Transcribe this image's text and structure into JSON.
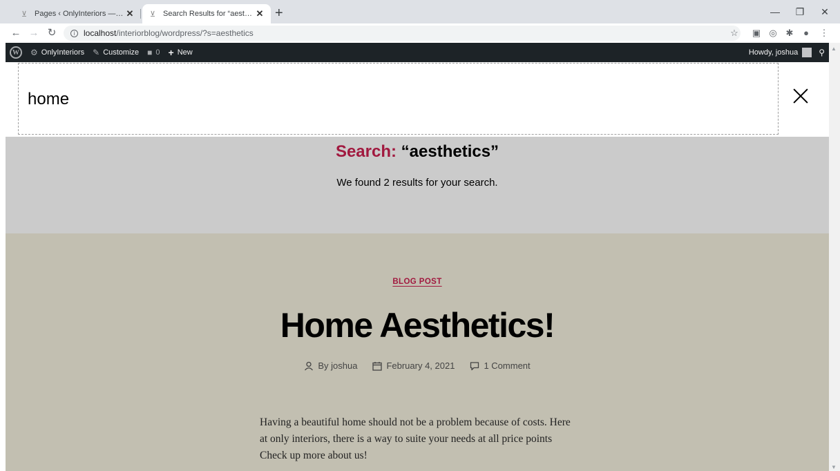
{
  "browser": {
    "tabs": [
      {
        "title": "Pages ‹ OnlyInteriors — WordPress",
        "active": false
      },
      {
        "title": "Search Results for “aesthetics” – OnlyInteriors",
        "active": true
      }
    ],
    "address": {
      "host": "localhost",
      "path": "/interiorblog/wordpress/?s=aesthetics"
    }
  },
  "adminbar": {
    "site_name": "OnlyInteriors",
    "customize": "Customize",
    "comments_count": "0",
    "new": "New",
    "howdy": "Howdy, joshua"
  },
  "search": {
    "value": "home"
  },
  "archive": {
    "prefix": "Search:",
    "query": "“aesthetics”",
    "subtitle": "We found 2 results for your search."
  },
  "post": {
    "category": "BLOG POST",
    "title": "Home Aesthetics!",
    "author": "By joshua",
    "date": "February 4, 2021",
    "comments": "1 Comment",
    "excerpt": "Having a beautiful home should not be a problem because of costs. Here at only interiors, there is a way to suite your needs at all price points Check up more about us!"
  },
  "colors": {
    "accent": "#a1193f",
    "header_bg": "#cbcbcb",
    "post_bg": "#c2bfb1",
    "adminbar_bg": "#1d2327"
  }
}
